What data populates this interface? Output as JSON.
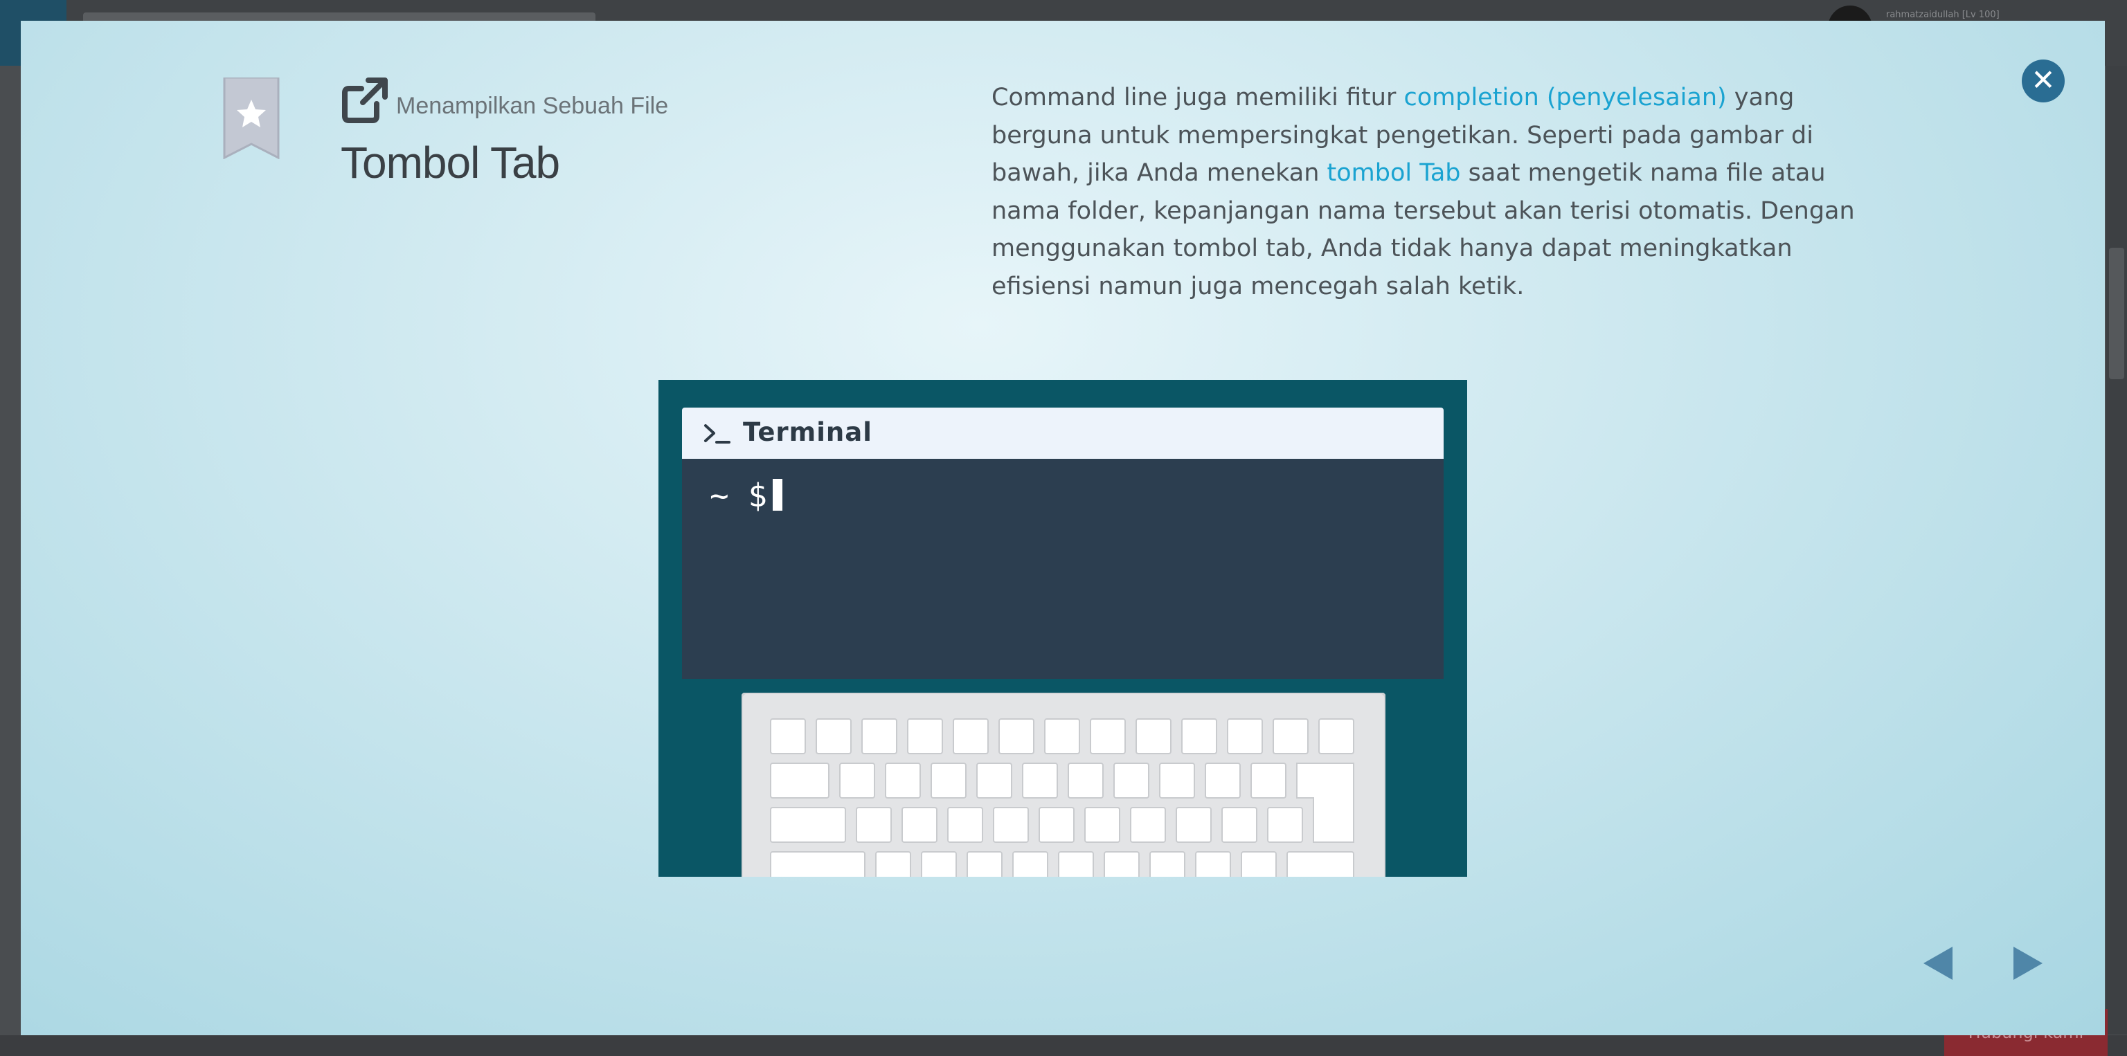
{
  "background": {
    "user_label": "rahmatzaidullah [Lv 100]",
    "action_button_label": "Hubungi kami"
  },
  "modal": {
    "subtitle": "Menampilkan Sebuah File",
    "title": "Tombol Tab",
    "description": {
      "part1": "Command line juga memiliki fitur ",
      "link1": "completion (penyelesaian)",
      "part2": " yang berguna untuk mempersingkat pengetikan. Seperti pada gambar di bawah, jika Anda menekan ",
      "link2": "tombol Tab",
      "part3": " saat mengetik nama file atau nama folder, kepanjangan nama tersebut akan terisi otomatis. Dengan menggunakan tombol tab, Anda tidak hanya dapat meningkatkan efisiensi namun juga mencegah salah ketik."
    },
    "close_icon": "close-icon",
    "bookmark_icon": "bookmark-star-icon",
    "external_icon": "external-link-icon",
    "colors": {
      "accent": "#1aa3d1",
      "close_button": "#2a6d93",
      "nav_arrow": "#4f86a8",
      "illustration_bg": "#0a5665",
      "terminal_bg": "#2c3e50"
    }
  },
  "illustration": {
    "terminal_title": "Terminal",
    "prompt": "~ $"
  },
  "navigation": {
    "prev_icon": "arrow-left-icon",
    "next_icon": "arrow-right-icon"
  }
}
